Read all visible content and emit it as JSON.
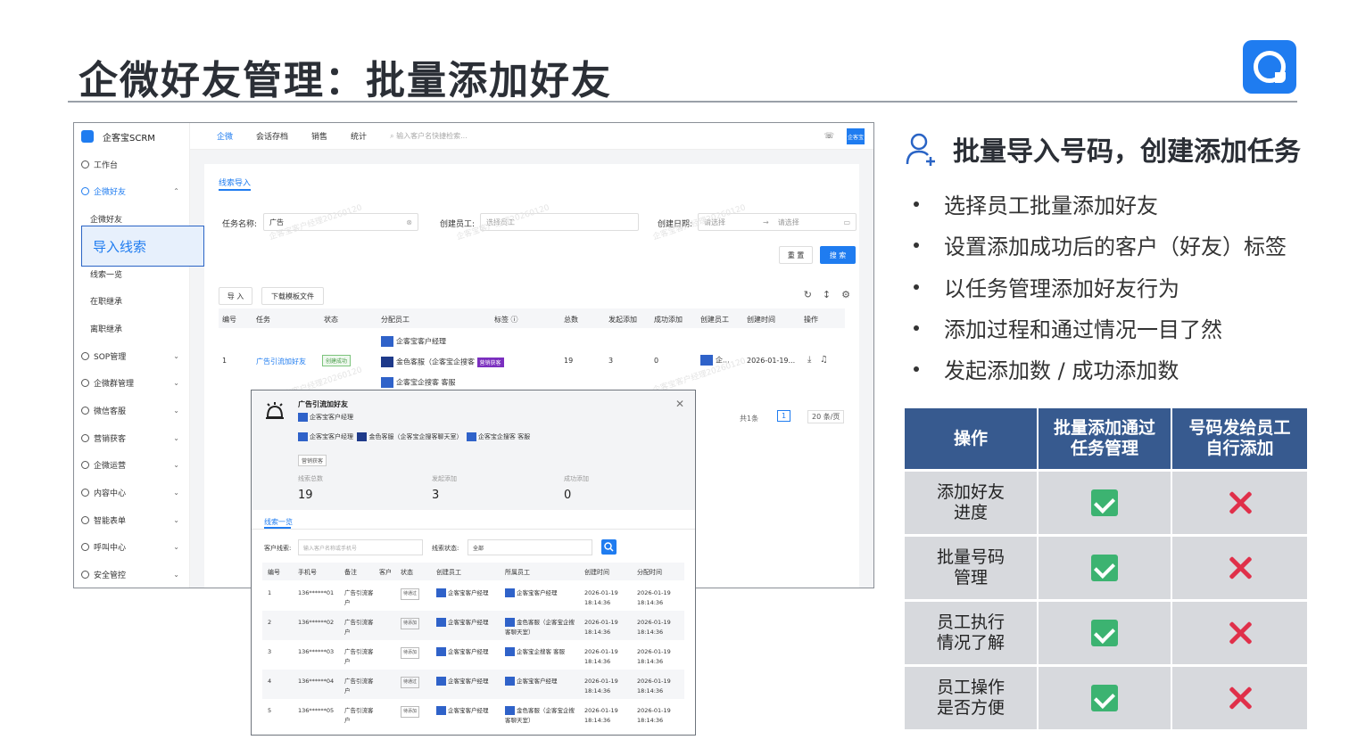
{
  "slide": {
    "title": "企微好友管理：批量添加好友"
  },
  "app": {
    "brand": "企客宝SCRM",
    "top_tabs": [
      "企微",
      "会话存档",
      "销售",
      "统计"
    ],
    "top_search_placeholder": "输入客户名快捷检索...",
    "avatar_label": "企客宝",
    "sidebar": {
      "workbench": "工作台",
      "wechat_friends": "企微好友",
      "sub_friends": "企微好友",
      "import_leads": "导入线索",
      "leads_list": "线索一览",
      "on_job_inherit": "在职继承",
      "off_job_inherit": "离职继承",
      "sections": [
        "SOP管理",
        "企微群管理",
        "微信客服",
        "营销获客",
        "企微运营",
        "内容中心",
        "智能表单",
        "呼叫中心",
        "安全管控"
      ]
    },
    "crumb": "线索导入",
    "filters": {
      "task_name_label": "任务名称:",
      "task_name_value": "广告",
      "creator_label": "创建员工:",
      "creator_placeholder": "选择员工",
      "date_label": "创建日期:",
      "date_start": "请选择",
      "date_end": "请选择",
      "date_sep": "→"
    },
    "buttons": {
      "reset": "重 置",
      "search": "搜 索",
      "import": "导 入",
      "download_template": "下载模板文件"
    },
    "table_headers": [
      "编号",
      "任务",
      "状态",
      "分配员工",
      "标签 ⓘ",
      "总数",
      "发起添加",
      "成功添加",
      "创建员工",
      "创建时间",
      "操作"
    ],
    "row": {
      "id": "1",
      "task": "广告引流加好友",
      "status": "创建成功",
      "staff": [
        "企客宝客户经理",
        "金色客服（企客宝企搜客",
        "企客宝企搜客 客服"
      ],
      "tag": "营销获客",
      "total": "19",
      "initiated": "3",
      "success": "0",
      "creator": "企...",
      "created": "2026-01-19..."
    },
    "pagination": {
      "total": "共1条",
      "page": "1",
      "page_size": "20 条/页"
    },
    "watermark": "企客宝客户经理20260120"
  },
  "modal": {
    "title": "广告引流加好友",
    "line1": "企客宝客户经理",
    "line2_a": "企客宝客户经理",
    "line2_b": "金色客服（企客宝企搜客聊天室）",
    "line2_c": "企客宝企搜客 客服",
    "badge": "营销获客",
    "stat_labels": [
      "线索总数",
      "发起添加",
      "成功添加"
    ],
    "stat_values": [
      "19",
      "3",
      "0"
    ],
    "tab": "线索一览",
    "filter_customer_label": "客户线索:",
    "filter_customer_placeholder": "输入客户名称或手机号",
    "filter_status_label": "线索状态:",
    "filter_status_value": "全部",
    "headers": [
      "编号",
      "手机号",
      "备注",
      "客户",
      "状态",
      "创建员工",
      "所属员工",
      "创建时间",
      "分配时间"
    ],
    "rows": [
      {
        "id": "1",
        "phone": "136******01",
        "note": "广告引流客户",
        "status": "待通过",
        "creator": "企客宝客户经理",
        "owner": "企客宝客户经理",
        "created": "2026-01-19 18:14:36",
        "assigned": "2026-01-19 18:14:36"
      },
      {
        "id": "2",
        "phone": "136******02",
        "note": "广告引流客户",
        "status": "待添加",
        "creator": "企客宝客户经理",
        "owner": "金色客服（企客宝企搜客聊天室）",
        "created": "2026-01-19 18:14:36",
        "assigned": "2026-01-19 18:14:36"
      },
      {
        "id": "3",
        "phone": "136******03",
        "note": "广告引流客户",
        "status": "待添加",
        "creator": "企客宝客户经理",
        "owner": "企客宝企搜客 客服",
        "created": "2026-01-19 18:14:36",
        "assigned": "2026-01-19 18:14:36"
      },
      {
        "id": "4",
        "phone": "136******04",
        "note": "广告引流客户",
        "status": "待通过",
        "creator": "企客宝客户经理",
        "owner": "企客宝客户经理",
        "created": "2026-01-19 18:14:36",
        "assigned": "2026-01-19 18:14:36"
      },
      {
        "id": "5",
        "phone": "136******05",
        "note": "广告引流客户",
        "status": "待添加",
        "creator": "企客宝客户经理",
        "owner": "金色客服（企客宝企搜客聊天室）",
        "created": "2026-01-19 18:14:36",
        "assigned": "2026-01-19 18:14:36"
      }
    ]
  },
  "right": {
    "heading": "批量导入号码，创建添加任务",
    "bullets": [
      "选择员工批量添加好友",
      "设置添加成功后的客户（好友）标签",
      "以任务管理添加好友行为",
      "添加过程和通过情况一目了然",
      "发起添加数 / 成功添加数"
    ],
    "compare_table": {
      "headers": [
        "操作",
        "批量添加通过\n任务管理",
        "号码发给员工\n自行添加"
      ],
      "rows": [
        {
          "label": "添加好友\n进度",
          "a": "check",
          "b": "cross"
        },
        {
          "label": "批量号码\n管理",
          "a": "check",
          "b": "cross"
        },
        {
          "label": "员工执行\n情况了解",
          "a": "check",
          "b": "cross"
        },
        {
          "label": "员工操作\n是否方便",
          "a": "check",
          "b": "cross"
        }
      ]
    }
  },
  "colors": {
    "accent": "#1f7cf0",
    "table_header": "#375a8f",
    "table_body": "#d7d9dd",
    "check": "#3cb371",
    "cross": "#e0304a"
  }
}
